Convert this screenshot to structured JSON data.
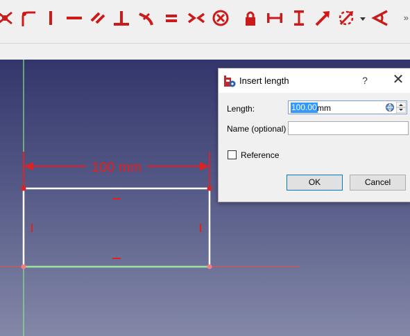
{
  "toolbar": {
    "items": [
      {
        "name": "point-tool-icon"
      },
      {
        "name": "fillet-tool-icon"
      },
      {
        "name": "vertical-constraint-icon"
      },
      {
        "name": "horizontal-constraint-icon"
      },
      {
        "name": "parallel-constraint-icon"
      },
      {
        "name": "perpendicular-constraint-icon"
      },
      {
        "name": "tangent-constraint-icon"
      },
      {
        "name": "equal-constraint-icon"
      },
      {
        "name": "symmetric-constraint-icon"
      },
      {
        "name": "block-constraint-icon"
      },
      {
        "name": "lock-constraint-icon"
      },
      {
        "name": "horizontal-distance-icon"
      },
      {
        "name": "vertical-distance-icon"
      },
      {
        "name": "length-constraint-icon"
      },
      {
        "name": "radius-constraint-icon"
      },
      {
        "name": "angle-constraint-icon"
      }
    ],
    "more_label": "»",
    "accent": "#cc1a1a"
  },
  "sketch": {
    "dimension_label": "100 mm",
    "constraint_color": "#e22020",
    "geometry_color": "#ffffff",
    "axis_x_color": "#e05252",
    "axis_y_color": "#8ee68e"
  },
  "dialog": {
    "title": "Insert length",
    "help_label": "?",
    "close_label": "✕",
    "length_label": "Length:",
    "length_value": "100.00",
    "length_unit": "mm",
    "name_label": "Name (optional)",
    "name_value": "",
    "reference_label": "Reference",
    "reference_checked": false,
    "ok_label": "OK",
    "cancel_label": "Cancel"
  }
}
